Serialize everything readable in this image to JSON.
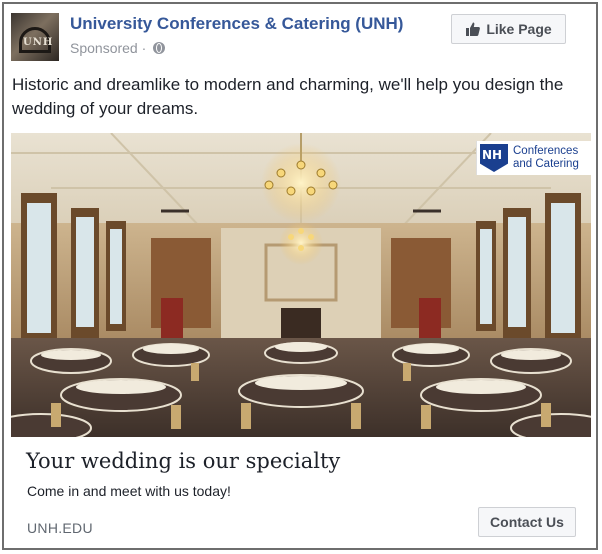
{
  "header": {
    "page_name": "University Conferences & Catering (UNH)",
    "sponsored_label": "Sponsored",
    "separator": " · ",
    "privacy_icon": "globe-icon",
    "avatar_text": "UNH"
  },
  "like_button": {
    "label": "Like Page",
    "icon": "thumbs-up-icon"
  },
  "post": {
    "text": "Historic and dreamlike to modern and charming, we'll help you design the wedding of your dreams."
  },
  "image": {
    "brand_mark": "NH",
    "brand_line1": "Conferences",
    "brand_line2": "and Catering"
  },
  "link": {
    "headline": "Your wedding is our specialty",
    "description": "Come in and meet with us today!",
    "domain": "UNH.EDU",
    "cta_label": "Contact Us"
  },
  "colors": {
    "link_blue": "#365899",
    "brand_blue": "#1a3f8f",
    "button_bg": "#f6f7f9",
    "meta_gray": "#90949c"
  }
}
